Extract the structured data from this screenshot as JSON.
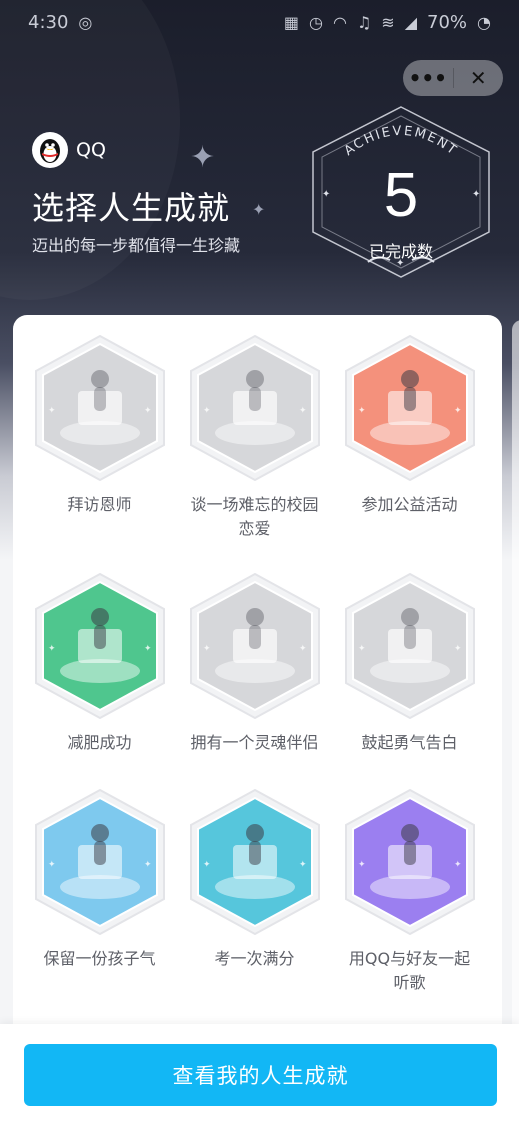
{
  "status_bar": {
    "time": "4:30",
    "battery": "70%"
  },
  "capsule": {
    "more_glyph": "•••",
    "close_glyph": "✕"
  },
  "brand": {
    "name": "QQ",
    "icon": "qq-penguin-icon"
  },
  "header": {
    "title": "选择人生成就",
    "subtitle": "迈出的每一步都值得一生珍藏"
  },
  "badge": {
    "ring_text": "ACHIEVEMENT",
    "count": "5",
    "caption": "已完成数"
  },
  "achievements": [
    {
      "label": "拜访恩师",
      "line2": "",
      "theme": "gray",
      "icon": "stairs-teacher-illustration"
    },
    {
      "label": "谈一场难忘的校园",
      "line2": "恋爱",
      "theme": "gray",
      "icon": "book-couple-illustration"
    },
    {
      "label": "参加公益活动",
      "line2": "",
      "theme": "#f4917c",
      "icon": "donation-box-illustration"
    },
    {
      "label": "减肥成功",
      "line2": "",
      "theme": "#4fc68e",
      "icon": "bowl-swimmer-illustration"
    },
    {
      "label": "拥有一个灵魂伴侣",
      "line2": "",
      "theme": "gray",
      "icon": "mirror-girl-illustration"
    },
    {
      "label": "鼓起勇气告白",
      "line2": "",
      "theme": "gray",
      "icon": "love-letter-illustration"
    },
    {
      "label": "保留一份孩子气",
      "line2": "",
      "theme": "#7ec9ee",
      "icon": "fish-rider-illustration"
    },
    {
      "label": "考一次满分",
      "line2": "",
      "theme": "#56c6dc",
      "icon": "exam-paper-illustration"
    },
    {
      "label": "用QQ与好友一起",
      "line2": "听歌",
      "theme": "#9b7ff0",
      "icon": "earbuds-dancers-illustration"
    }
  ],
  "cta": {
    "label": "查看我的人生成就"
  }
}
